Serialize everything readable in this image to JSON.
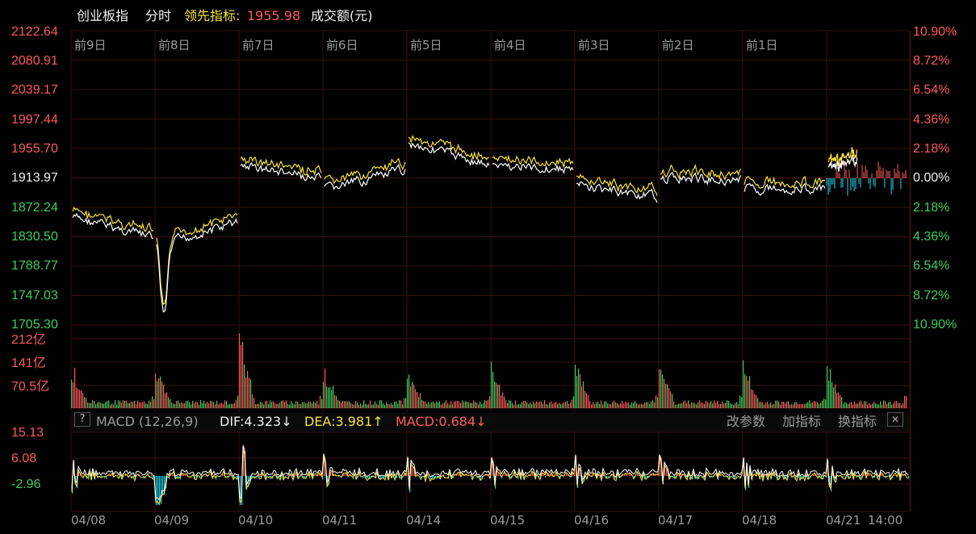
{
  "header": {
    "index_name": "创业板指",
    "chart_mode": "分时",
    "leader_label": "领先指标:",
    "leader_value": "1955.98",
    "volume_label": "成交额(元)"
  },
  "price_axis_left": [
    "2122.64",
    "2080.91",
    "2039.17",
    "1997.44",
    "1955.70",
    "1913.97",
    "1872.24",
    "1830.50",
    "1788.77",
    "1747.03",
    "1705.30"
  ],
  "pct_axis_right": [
    "10.90%",
    "8.72%",
    "6.54%",
    "4.36%",
    "2.18%",
    "0.00%",
    "2.18%",
    "4.36%",
    "6.54%",
    "8.72%",
    "10.90%"
  ],
  "day_labels": [
    "前9日",
    "前8日",
    "前7日",
    "前6日",
    "前5日",
    "前4日",
    "前3日",
    "前2日",
    "前1日"
  ],
  "volume_axis": [
    "212亿",
    "141亿",
    "70.5亿"
  ],
  "macd": {
    "help": "?",
    "title": "MACD (12,26,9)",
    "dif": "DIF:4.323↓",
    "dea": "DEA:3.981↑",
    "macd": "MACD:0.684↓",
    "btn_params": "改参数",
    "btn_add": "加指标",
    "btn_switch": "换指标",
    "btn_close": "✕",
    "axis": [
      "15.13",
      "6.08",
      "-2.96"
    ]
  },
  "date_labels": [
    "04/08",
    "04/09",
    "04/10",
    "04/11",
    "04/14",
    "04/15",
    "04/16",
    "04/17",
    "04/18",
    "04/21",
    "14:00"
  ],
  "colors": {
    "up": "#ff5a5a",
    "down": "#3ecf5e",
    "price_line": "#ffffff",
    "leader_line": "#f5e33a",
    "macd_neg": "#20d8f0",
    "grid": "#3a1010"
  }
}
